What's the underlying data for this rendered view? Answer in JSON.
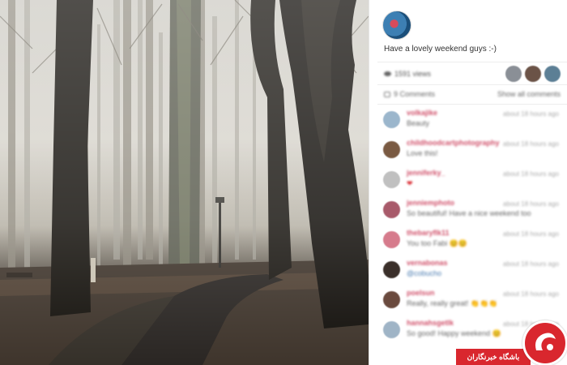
{
  "post": {
    "caption": "Have a lovely weekend guys :-)",
    "views": "1591 views",
    "comments_count": "9 Comments",
    "show_all": "Show all comments"
  },
  "likers": [
    {
      "color": "#8a8f96"
    },
    {
      "color": "#6b5347"
    },
    {
      "color": "#5c7f95"
    }
  ],
  "comments": [
    {
      "user": "volkajike",
      "text": "Beauty",
      "time": "about 18 hours ago",
      "avatar_color": "#9bb6cc"
    },
    {
      "user": "childhoodcartphotography",
      "text": "Love this!",
      "time": "about 18 hours ago",
      "avatar_color": "#7a5a42"
    },
    {
      "user": "jenniferky_",
      "text": "❤",
      "time": "about 18 hours ago",
      "avatar_color": "#c0c0c0"
    },
    {
      "user": "jenniemphoto",
      "text": "So beautiful! Have a nice weekend too",
      "time": "about 18 hours ago",
      "avatar_color": "#a85a6a"
    },
    {
      "user": "thebaryflk11",
      "text": "You too Fabi 😊😊",
      "time": "about 18 hours ago",
      "avatar_color": "#d67b8c"
    },
    {
      "user": "vernabonas",
      "text": "@cobucho",
      "time": "about 18 hours ago",
      "avatar_color": "#3a2f2a"
    },
    {
      "user": "poelsun",
      "text": "Really, really great! 👏👏👏",
      "time": "about 18 hours ago",
      "avatar_color": "#6a4a3e"
    },
    {
      "user": "hannahsgetlk",
      "text": "So good! Happy weekend 😊",
      "time": "about 18 hours ago",
      "avatar_color": "#9fb4c6"
    }
  ],
  "watermark": {
    "name": "باشگاه خبرنگاران",
    "color": "#d9272e"
  }
}
